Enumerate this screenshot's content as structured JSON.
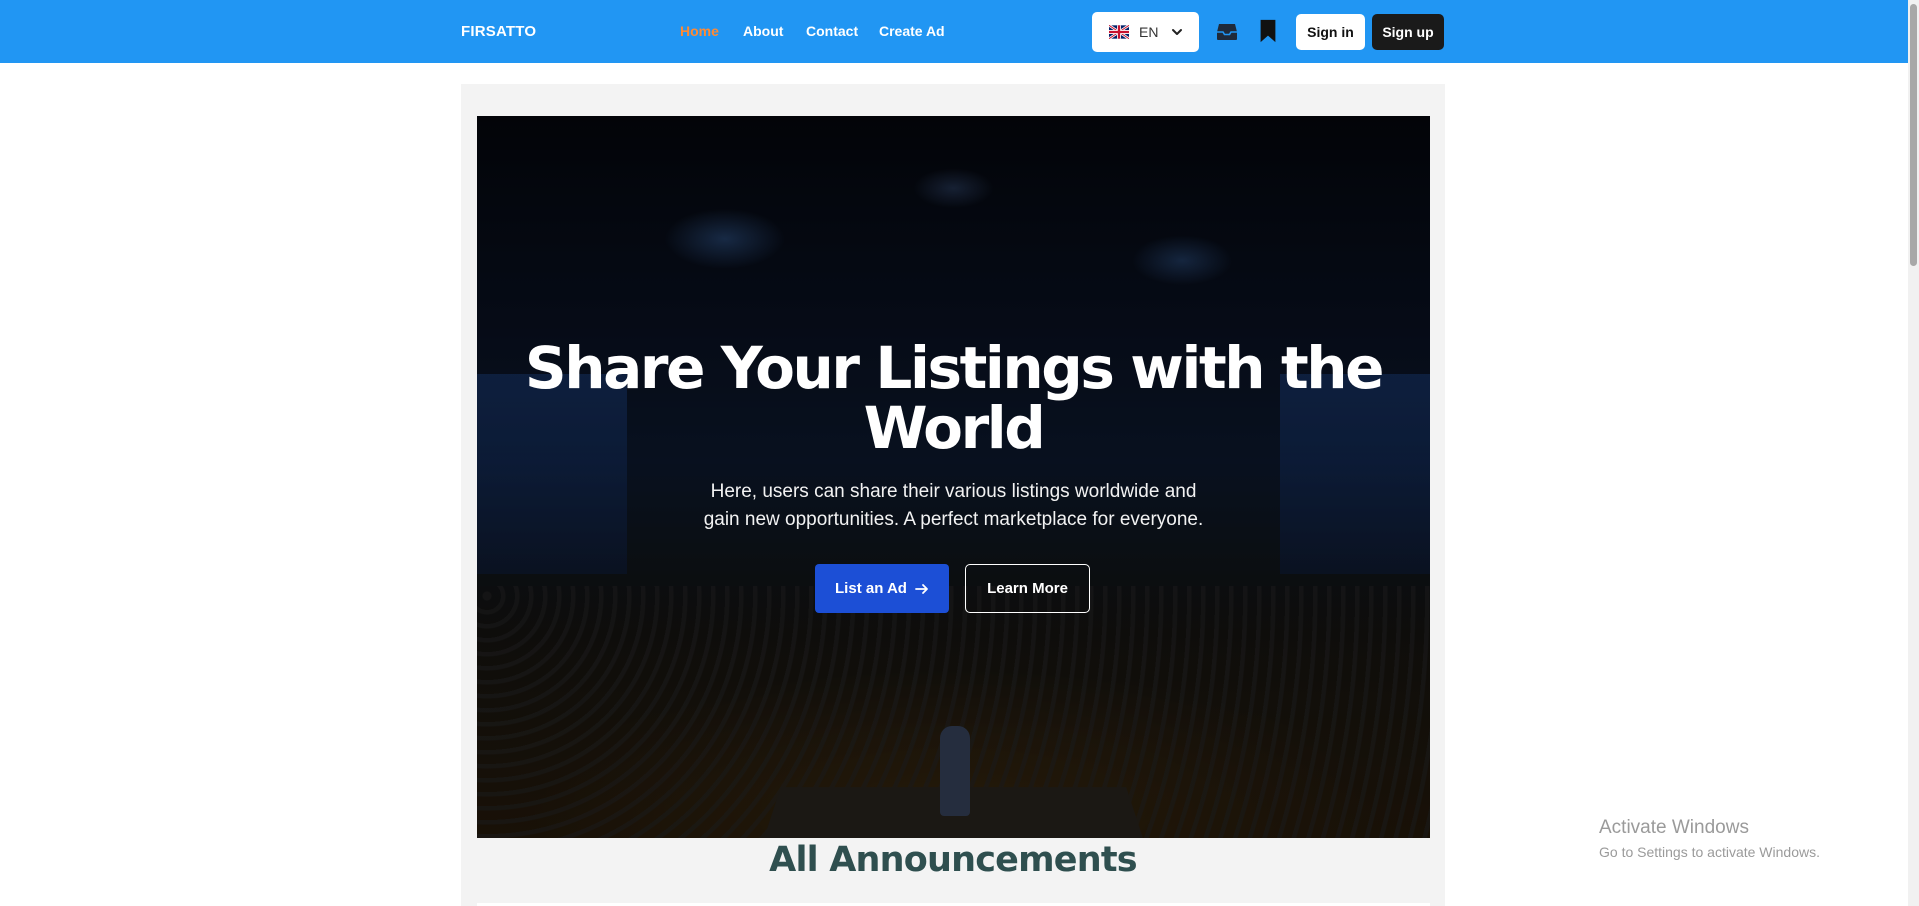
{
  "header": {
    "brand": "FIRSATTO",
    "nav": [
      {
        "label": "Home",
        "active": true
      },
      {
        "label": "About",
        "active": false
      },
      {
        "label": "Contact",
        "active": false
      },
      {
        "label": "Create Ad",
        "active": false
      }
    ],
    "language": {
      "code": "EN",
      "flag_icon": "uk-flag-icon"
    },
    "icons": [
      "inbox-icon",
      "bookmark-icon"
    ],
    "signin_label": "Sign in",
    "signup_label": "Sign up",
    "colors": {
      "bar": "#2196f3",
      "active_link": "#ff8a33",
      "signup_bg": "#1a1a1a"
    }
  },
  "hero": {
    "title_line1": "Share Your Listings with the",
    "title_line2": "World",
    "subtitle_line1": "Here, users can share their various listings worldwide and",
    "subtitle_line2": "gain new opportunities. A perfect marketplace for everyone.",
    "primary_button": "List an Ad",
    "secondary_button": "Learn More",
    "primary_color": "#1c4fd6"
  },
  "announcements": {
    "title": "All Announcements",
    "title_color": "#2f4f4f"
  },
  "os_watermark": {
    "line1": "Activate Windows",
    "line2": "Go to Settings to activate Windows."
  }
}
